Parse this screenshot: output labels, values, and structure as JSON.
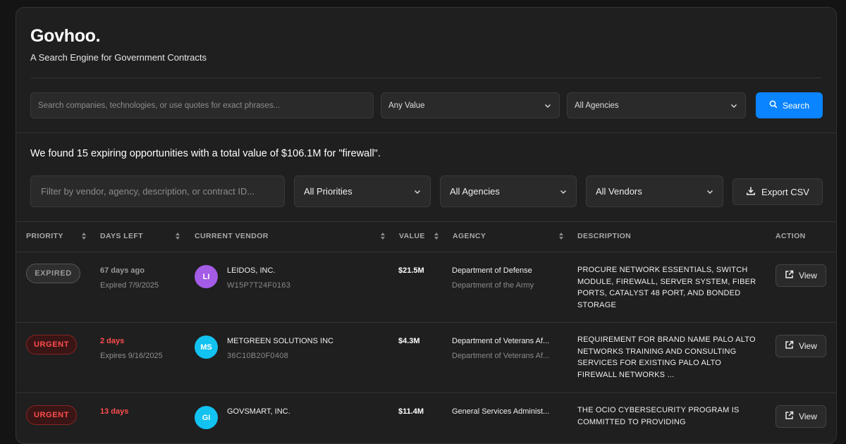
{
  "brand": {
    "name": "Govhoo.",
    "tagline": "A Search Engine for Government Contracts"
  },
  "search": {
    "placeholder": "Search companies, technologies, or use quotes for exact phrases...",
    "value_select": "Any Value",
    "agency_select": "All Agencies",
    "button_label": "Search"
  },
  "summary": "We found 15 expiring opportunities with a total value of $106.1M for \"firewall\".",
  "filters": {
    "placeholder": "Filter by vendor, agency, description, or contract ID...",
    "priority": "All Priorities",
    "agency": "All Agencies",
    "vendor": "All Vendors",
    "export_label": "Export CSV"
  },
  "columns": {
    "priority": "PRIORITY",
    "days_left": "DAYS LEFT",
    "vendor": "CURRENT VENDOR",
    "value": "VALUE",
    "agency": "AGENCY",
    "description": "DESCRIPTION",
    "action": "ACTION"
  },
  "rows": [
    {
      "priority": "EXPIRED",
      "days": "67 days ago",
      "expires": "Expired 7/9/2025",
      "initials": "LI",
      "vendor": "LEIDOS, INC.",
      "contract_id": "W15P7T24F0163",
      "value": "$21.5M",
      "agency": "Department of Defense",
      "subagency": "Department of the Army",
      "description": "PROCURE NETWORK ESSENTIALS, SWITCH MODULE, FIREWALL, SERVER SYSTEM, FIBER PORTS, CATALYST 48 PORT, AND BONDED STORAGE",
      "action": "View"
    },
    {
      "priority": "URGENT",
      "days": "2 days",
      "expires": "Expires 9/16/2025",
      "initials": "MS",
      "vendor": "METGREEN SOLUTIONS INC",
      "contract_id": "36C10B20F0408",
      "value": "$4.3M",
      "agency": "Department of Veterans Af...",
      "subagency": "Department of Veterans Af...",
      "description": "REQUIREMENT FOR BRAND NAME PALO ALTO NETWORKS TRAINING AND CONSULTING SERVICES FOR EXISTING PALO ALTO FIREWALL NETWORKS ...",
      "action": "View"
    },
    {
      "priority": "URGENT",
      "days": "13 days",
      "expires": "",
      "initials": "GI",
      "vendor": "GOVSMART, INC.",
      "contract_id": "",
      "value": "$11.4M",
      "agency": "General Services Administ...",
      "subagency": "",
      "description": "THE OCIO CYBERSECURITY PROGRAM IS COMMITTED TO PROVIDING",
      "action": "View"
    }
  ],
  "colors": {
    "accent": "#0a84ff",
    "urgent": "#ff4d4d",
    "avatar_li": "#a45be6",
    "avatar_ms": "#12c2f0",
    "avatar_gi": "#12c2f0"
  }
}
